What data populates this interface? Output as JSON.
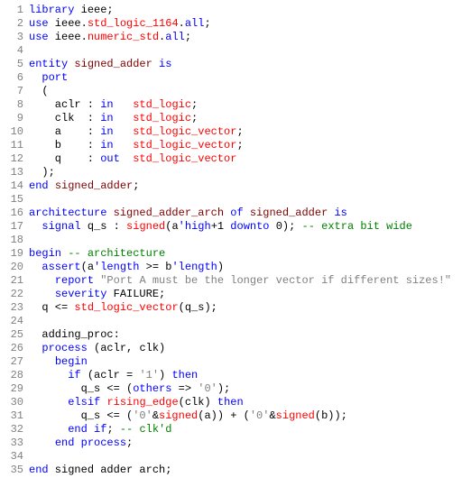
{
  "lines": [
    {
      "n": "1",
      "seg": [
        {
          "c": "kw",
          "t": "library"
        },
        {
          "t": " ieee;"
        }
      ]
    },
    {
      "n": "2",
      "seg": [
        {
          "c": "kw",
          "t": "use"
        },
        {
          "t": " ieee."
        },
        {
          "c": "type",
          "t": "std_logic_1164"
        },
        {
          "t": "."
        },
        {
          "c": "kw",
          "t": "all"
        },
        {
          "t": ";"
        }
      ]
    },
    {
      "n": "3",
      "seg": [
        {
          "c": "kw",
          "t": "use"
        },
        {
          "t": " ieee."
        },
        {
          "c": "type",
          "t": "numeric_std"
        },
        {
          "t": "."
        },
        {
          "c": "kw",
          "t": "all"
        },
        {
          "t": ";"
        }
      ]
    },
    {
      "n": "4",
      "seg": [
        {
          "t": ""
        }
      ]
    },
    {
      "n": "5",
      "seg": [
        {
          "c": "kw",
          "t": "entity"
        },
        {
          "t": " "
        },
        {
          "c": "fn",
          "t": "signed_adder"
        },
        {
          "t": " "
        },
        {
          "c": "kw",
          "t": "is"
        }
      ]
    },
    {
      "n": "6",
      "seg": [
        {
          "t": "  "
        },
        {
          "c": "kw",
          "t": "port"
        }
      ]
    },
    {
      "n": "7",
      "seg": [
        {
          "t": "  ("
        }
      ]
    },
    {
      "n": "8",
      "seg": [
        {
          "t": "    aclr : "
        },
        {
          "c": "kw",
          "t": "in"
        },
        {
          "t": "   "
        },
        {
          "c": "type",
          "t": "std_logic"
        },
        {
          "t": ";"
        }
      ]
    },
    {
      "n": "9",
      "seg": [
        {
          "t": "    clk  : "
        },
        {
          "c": "kw",
          "t": "in"
        },
        {
          "t": "   "
        },
        {
          "c": "type",
          "t": "std_logic"
        },
        {
          "t": ";"
        }
      ]
    },
    {
      "n": "10",
      "seg": [
        {
          "t": "    a    : "
        },
        {
          "c": "kw",
          "t": "in"
        },
        {
          "t": "   "
        },
        {
          "c": "type",
          "t": "std_logic_vector"
        },
        {
          "t": ";"
        }
      ]
    },
    {
      "n": "11",
      "seg": [
        {
          "t": "    b    : "
        },
        {
          "c": "kw",
          "t": "in"
        },
        {
          "t": "   "
        },
        {
          "c": "type",
          "t": "std_logic_vector"
        },
        {
          "t": ";"
        }
      ]
    },
    {
      "n": "12",
      "seg": [
        {
          "t": "    q    : "
        },
        {
          "c": "kw",
          "t": "out"
        },
        {
          "t": "  "
        },
        {
          "c": "type",
          "t": "std_logic_vector"
        }
      ]
    },
    {
      "n": "13",
      "seg": [
        {
          "t": "  );"
        }
      ]
    },
    {
      "n": "14",
      "seg": [
        {
          "c": "kw",
          "t": "end"
        },
        {
          "t": " "
        },
        {
          "c": "fn",
          "t": "signed_adder"
        },
        {
          "t": ";"
        }
      ]
    },
    {
      "n": "15",
      "seg": [
        {
          "t": ""
        }
      ]
    },
    {
      "n": "16",
      "seg": [
        {
          "c": "kw",
          "t": "architecture"
        },
        {
          "t": " "
        },
        {
          "c": "fn",
          "t": "signed_adder_arch"
        },
        {
          "t": " "
        },
        {
          "c": "kw",
          "t": "of"
        },
        {
          "t": " "
        },
        {
          "c": "fn",
          "t": "signed_adder"
        },
        {
          "t": " "
        },
        {
          "c": "kw",
          "t": "is"
        }
      ]
    },
    {
      "n": "17",
      "seg": [
        {
          "t": "  "
        },
        {
          "c": "kw",
          "t": "signal"
        },
        {
          "t": " q_s : "
        },
        {
          "c": "type",
          "t": "signed"
        },
        {
          "t": "(a"
        },
        {
          "c": "kw",
          "t": "'high"
        },
        {
          "t": "+1 "
        },
        {
          "c": "kw",
          "t": "downto"
        },
        {
          "t": " 0); "
        },
        {
          "c": "cmt",
          "t": "-- extra bit wide"
        }
      ]
    },
    {
      "n": "18",
      "seg": [
        {
          "t": ""
        }
      ]
    },
    {
      "n": "19",
      "seg": [
        {
          "c": "kw",
          "t": "begin"
        },
        {
          "t": " "
        },
        {
          "c": "cmt",
          "t": "-- architecture"
        }
      ]
    },
    {
      "n": "20",
      "seg": [
        {
          "t": "  "
        },
        {
          "c": "kw",
          "t": "assert"
        },
        {
          "t": "(a"
        },
        {
          "c": "kw",
          "t": "'length"
        },
        {
          "t": " >= b"
        },
        {
          "c": "kw",
          "t": "'length"
        },
        {
          "t": ")"
        }
      ]
    },
    {
      "n": "21",
      "seg": [
        {
          "t": "    "
        },
        {
          "c": "kw",
          "t": "report"
        },
        {
          "t": " "
        },
        {
          "c": "str",
          "t": "\"Port A must be the longer vector if different sizes!\""
        }
      ]
    },
    {
      "n": "22",
      "seg": [
        {
          "t": "    "
        },
        {
          "c": "kw",
          "t": "severity"
        },
        {
          "t": " FAILURE;"
        }
      ]
    },
    {
      "n": "23",
      "seg": [
        {
          "t": "  q <= "
        },
        {
          "c": "type",
          "t": "std_logic_vector"
        },
        {
          "t": "(q_s);"
        }
      ]
    },
    {
      "n": "24",
      "seg": [
        {
          "t": ""
        }
      ]
    },
    {
      "n": "25",
      "seg": [
        {
          "t": "  adding_proc:"
        }
      ]
    },
    {
      "n": "26",
      "seg": [
        {
          "t": "  "
        },
        {
          "c": "kw",
          "t": "process"
        },
        {
          "t": " (aclr, clk)"
        }
      ]
    },
    {
      "n": "27",
      "seg": [
        {
          "t": "    "
        },
        {
          "c": "kw",
          "t": "begin"
        }
      ]
    },
    {
      "n": "28",
      "seg": [
        {
          "t": "      "
        },
        {
          "c": "kw",
          "t": "if"
        },
        {
          "t": " (aclr = "
        },
        {
          "c": "str",
          "t": "'1'"
        },
        {
          "t": ") "
        },
        {
          "c": "kw",
          "t": "then"
        }
      ]
    },
    {
      "n": "29",
      "seg": [
        {
          "t": "        q_s <= ("
        },
        {
          "c": "kw",
          "t": "others"
        },
        {
          "t": " => "
        },
        {
          "c": "str",
          "t": "'0'"
        },
        {
          "t": ");"
        }
      ]
    },
    {
      "n": "30",
      "seg": [
        {
          "t": "      "
        },
        {
          "c": "kw",
          "t": "elsif"
        },
        {
          "t": " "
        },
        {
          "c": "type",
          "t": "rising_edge"
        },
        {
          "t": "(clk) "
        },
        {
          "c": "kw",
          "t": "then"
        }
      ]
    },
    {
      "n": "31",
      "seg": [
        {
          "t": "        q_s <= ("
        },
        {
          "c": "str",
          "t": "'0'"
        },
        {
          "t": "&"
        },
        {
          "c": "type",
          "t": "signed"
        },
        {
          "t": "(a)) + ("
        },
        {
          "c": "str",
          "t": "'0'"
        },
        {
          "t": "&"
        },
        {
          "c": "type",
          "t": "signed"
        },
        {
          "t": "(b));"
        }
      ]
    },
    {
      "n": "32",
      "seg": [
        {
          "t": "      "
        },
        {
          "c": "kw",
          "t": "end"
        },
        {
          "t": " "
        },
        {
          "c": "kw",
          "t": "if"
        },
        {
          "t": "; "
        },
        {
          "c": "cmt",
          "t": "-- clk'd"
        }
      ]
    },
    {
      "n": "33",
      "seg": [
        {
          "t": "    "
        },
        {
          "c": "kw",
          "t": "end"
        },
        {
          "t": " "
        },
        {
          "c": "kw",
          "t": "process"
        },
        {
          "t": ";"
        }
      ]
    },
    {
      "n": "34",
      "seg": [
        {
          "t": ""
        }
      ]
    },
    {
      "n": "35",
      "seg": [
        {
          "c": "kw",
          "t": "end"
        },
        {
          "t": " signed adder arch;"
        }
      ]
    }
  ]
}
